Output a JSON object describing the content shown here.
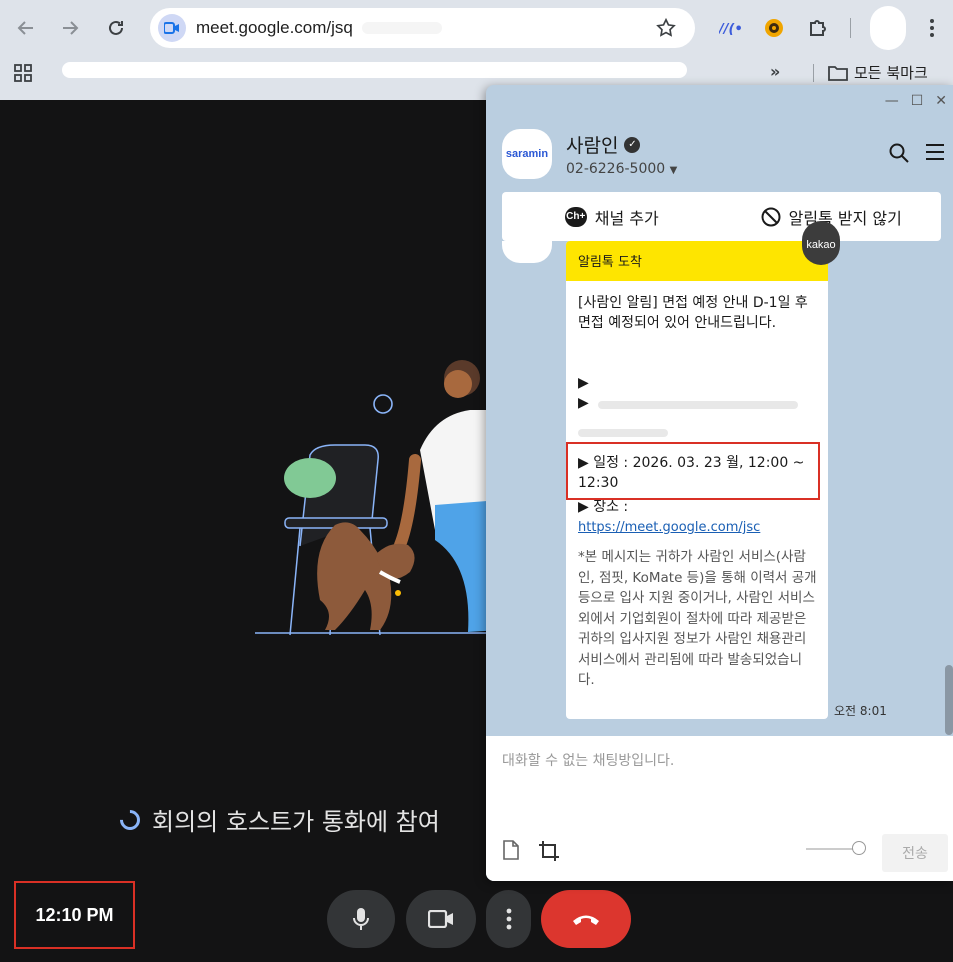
{
  "browser": {
    "url_visible": "meet.google.com/jsq",
    "bookmark_folder": "모든 북마크",
    "bookmarks_more": "»"
  },
  "meet": {
    "waiting_text": "회의의 호스트가 통화에 참여",
    "clock": "12:10 PM"
  },
  "kakao": {
    "channel_name": "사람인",
    "logo_text": "saramin",
    "phone": "02-6226-5000",
    "add_channel_label": "채널 추가",
    "block_label": "알림톡 받지 않기",
    "kakao_badge": "kakao",
    "message": {
      "header": "알림톡 도착",
      "body": "[사람인 알림] 면접 예정 안내 D-1일 후 면접 예정되어 있어 안내드립니다.",
      "bullet1": "▶",
      "bullet2": "▶",
      "schedule": "▶ 일정 : 2026. 03. 23 월, 12:00 ~ 12:30",
      "place_label": "▶ 장소 :",
      "place_link": "https://meet.google.com/jsc",
      "note": "*본 메시지는 귀하가 사람인 서비스(사람인, 점핏, KoMate 등)을 통해 이력서 공개 등으로 입사 지원 중이거나, 사람인 서비스 외에서 기업회원이 절차에 따라 제공받은 귀하의 입사지원 정보가 사람인 채용관리 서비스에서 관리됨에 따라 발송되었습니다.",
      "time": "오전 8:01"
    },
    "compose_placeholder": "대화할 수 없는 채팅방입니다.",
    "send_label": "전송"
  }
}
